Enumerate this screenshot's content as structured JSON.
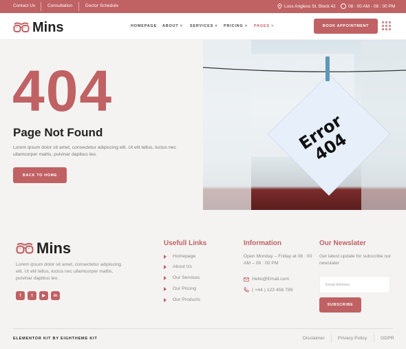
{
  "topbar": {
    "links": [
      "Contact Us",
      "Consultation",
      "Doctor Schedule"
    ],
    "address": "Loss Angless St. Block 42",
    "hours": "08 : 00 AM - 08 : 00 PM"
  },
  "brand": {
    "name": "Mins"
  },
  "nav": {
    "items": [
      {
        "label": "HOMEPAGE"
      },
      {
        "label": "ABOUT ˅"
      },
      {
        "label": "SERVICES ˅"
      },
      {
        "label": "PRICING ˅"
      },
      {
        "label": "PAGES ˅"
      }
    ],
    "book_label": "BOOK APPOINTMENT"
  },
  "hero": {
    "code": "404",
    "title": "Page Not Found",
    "text": "Lorem ipsum dolor sit amet, consectetur adipiscing elit. Ut elit tellus, luctus nec ullamcorper mattis, pulvinar dapibus leo.",
    "button": "BACK TO HOME",
    "note_line1": "Error",
    "note_line2": "404"
  },
  "footer": {
    "about": "Lorem ipsum dolor sit amet, consectetur adipiscing elit. Ut elit tellus, luctus nec ullamcorper mattis, pulvinar dapibus leo.",
    "socials": [
      "facebook-icon",
      "twitter-icon",
      "youtube-icon",
      "linkedin-icon"
    ],
    "links_title": "Usefull Links",
    "links": [
      "Homepage",
      "About Us",
      "Our Services",
      "Our Pricing",
      "Our Products"
    ],
    "info_title": "Information",
    "info_hours": "Open Monday – Friday at 08 : 00 AM – 08 : 00 PM",
    "info_email": "Hello@Email.com",
    "info_phone": "( +44 ) 123 456 789",
    "news_title": "Our Newslater",
    "news_text": "Get latest update for subscribe our newslater",
    "email_placeholder": "Email Address",
    "subscribe": "SUBSCRIBE",
    "credit": "ELEMENTOR KIT BY EIGHTHEME KIT",
    "bottom_links": [
      "Disclaimer",
      "Privacy Policy",
      "GDPR"
    ]
  },
  "colors": {
    "accent": "#c06163",
    "background": "#f4f3f2"
  }
}
